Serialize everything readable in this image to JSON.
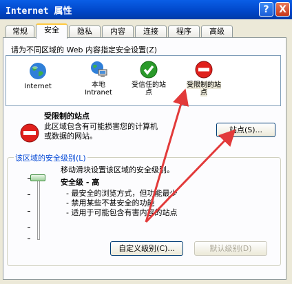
{
  "window": {
    "title": "Internet 属性",
    "help_label": "?",
    "close_label": "X"
  },
  "tabs": [
    {
      "label": "常规"
    },
    {
      "label": "安全"
    },
    {
      "label": "隐私"
    },
    {
      "label": "内容"
    },
    {
      "label": "连接"
    },
    {
      "label": "程序"
    },
    {
      "label": "高级"
    }
  ],
  "active_tab": "安全",
  "zones_prompt": "请为不同区域的 Web 内容指定安全设置(Z)",
  "zones": [
    {
      "line1": "Internet",
      "line2": "",
      "icon": "globe-icon"
    },
    {
      "line1": "本地",
      "line2": "Intranet",
      "icon": "local-intranet-icon"
    },
    {
      "line1": "受信任的站",
      "line2": "点",
      "icon": "check-icon"
    },
    {
      "line1": "受限制的站",
      "line2": "点",
      "icon": "restricted-icon"
    }
  ],
  "selected_zone": {
    "title": "受限制的站点",
    "desc_line1": "此区域包含有可能损害您的计算机",
    "desc_line2": "或数据的网站。",
    "sites_button": "站点(S)..."
  },
  "security_level": {
    "group_title": "该区域的安全级别(L)",
    "hint": "移动滑块设置该区域的安全级别。",
    "level_name": "安全级 - 高",
    "bullets": [
      "- 最安全的浏览方式，但功能最少",
      "- 禁用某些不甚安全的功能",
      "- 适用于可能包含有害内容的站点"
    ],
    "custom_button": "自定义级别(C)...",
    "default_button": "默认级别(D)"
  },
  "colors": {
    "title_bar": "#0a5ee6",
    "group_title": "#0046d5",
    "restricted": "#e0201c",
    "trusted": "#2a9a2a"
  }
}
